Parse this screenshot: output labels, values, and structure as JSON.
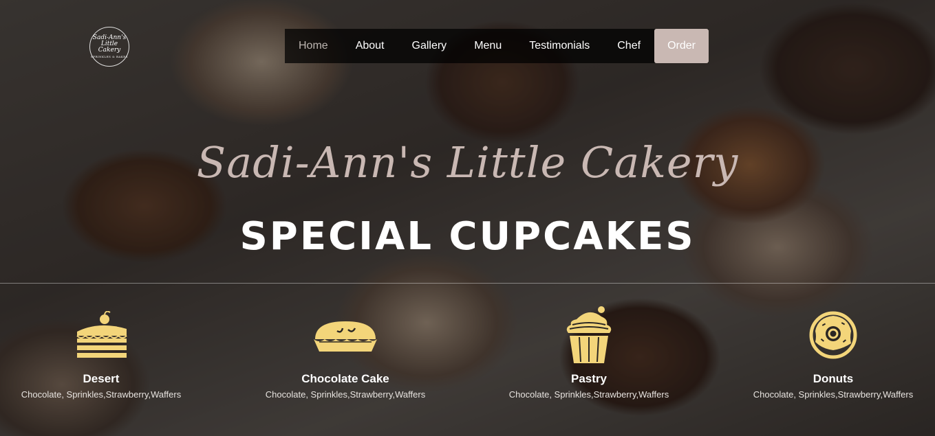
{
  "logo": {
    "line1": "Sadi-Ann's Little Cakery",
    "line2": "SPRINKLES & BAKES"
  },
  "nav": {
    "items": [
      "Home",
      "About",
      "Gallery",
      "Menu",
      "Testimonials",
      "Chef"
    ],
    "active": "Home",
    "order_label": "Order"
  },
  "hero": {
    "script_title": "Sadi-Ann's Little Cakery",
    "main_title": "SPECIAL CUPCAKES"
  },
  "features": [
    {
      "icon": "cake-slice-icon",
      "name": "Desert",
      "desc": "Chocolate, Sprinkles,Strawberry,Waffers"
    },
    {
      "icon": "pie-icon",
      "name": "Chocolate Cake",
      "desc": "Chocolate, Sprinkles,Strawberry,Waffers"
    },
    {
      "icon": "cupcake-icon",
      "name": "Pastry",
      "desc": "Chocolate, Sprinkles,Strawberry,Waffers"
    },
    {
      "icon": "donut-icon",
      "name": "Donuts",
      "desc": "Chocolate, Sprinkles,Strawberry,Waffers"
    }
  ],
  "colors": {
    "accent": "#c9b8b3",
    "icon_yellow": "#f3d57a",
    "nav_bg": "#000000"
  }
}
